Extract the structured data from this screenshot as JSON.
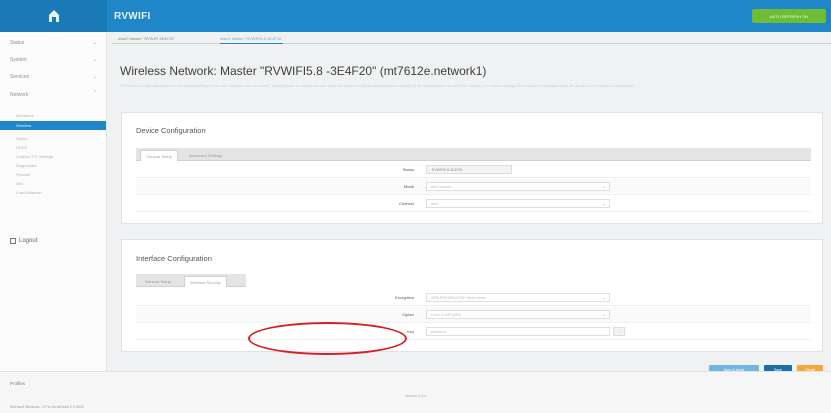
{
  "header": {
    "title": "RVWIFI",
    "refresh_label": "AUTO REFRESH ON"
  },
  "sidebar": {
    "items": [
      {
        "label": "Status"
      },
      {
        "label": "System"
      },
      {
        "label": "Services"
      },
      {
        "label": "Network"
      }
    ],
    "network_sub": [
      "Interfaces",
      "Wireless",
      "Switch",
      "DHCP",
      "Custom TTL Settings",
      "Diagnostics",
      "Firewall",
      "Sim",
      "Load Balancer"
    ],
    "active_sub": "Wireless",
    "logout": "Logout"
  },
  "net_tabs": [
    "wlan0 Master \"RVWIFI 3E4F20\"",
    "wlan1 Master \"RVWIFI5.8-3E4F20\""
  ],
  "page": {
    "title": "Wireless Network: Master \"RVWIFI5.8 -3E4F20\" (mt7612e.network1)",
    "description": "The Device Configuration section covers physical settings of the radio hardware such as channel, transmit power or antenna selection which are shared among all defined wireless networks (if the radio hardware is multi-SSID capable). Per network settings like encryption or operation mode are grouped in the Interface Configuration."
  },
  "device_config": {
    "title": "Device Configuration",
    "tabs": [
      "General Setup",
      "Advanced Settings"
    ],
    "rows": [
      {
        "label": "Status",
        "value": "RVWIFI5.8-3E4F20"
      },
      {
        "label": "Mode",
        "value": "802.11ac/n/a"
      },
      {
        "label": "Channel",
        "value": "Auto"
      }
    ]
  },
  "iface_config": {
    "title": "Interface Configuration",
    "tabs": [
      "General Setup",
      "Wireless Security"
    ],
    "rows": [
      {
        "label": "Encryption",
        "value": "WPA-PSK/WPA2-PSK Mixed Mode"
      },
      {
        "label": "Cipher",
        "value": "Force CCMP (AES)"
      },
      {
        "label": "Key",
        "value": "password"
      }
    ]
  },
  "actions": {
    "save_apply": "Save & Apply",
    "save": "Save",
    "reset": "Reset"
  },
  "footer": {
    "profile": "Profiles",
    "version": "Version: 1.0.0",
    "status": "Microsoft Windows - 0 Pro 64-bit build 0.0.0000"
  },
  "colors": {
    "primary": "#1f86c7",
    "accent_green": "#6fbd35",
    "save_apply_btn": "#6fb6e3",
    "save_btn": "#1c6fa6",
    "reset_btn": "#f4a93a",
    "highlight": "#d81f25"
  }
}
